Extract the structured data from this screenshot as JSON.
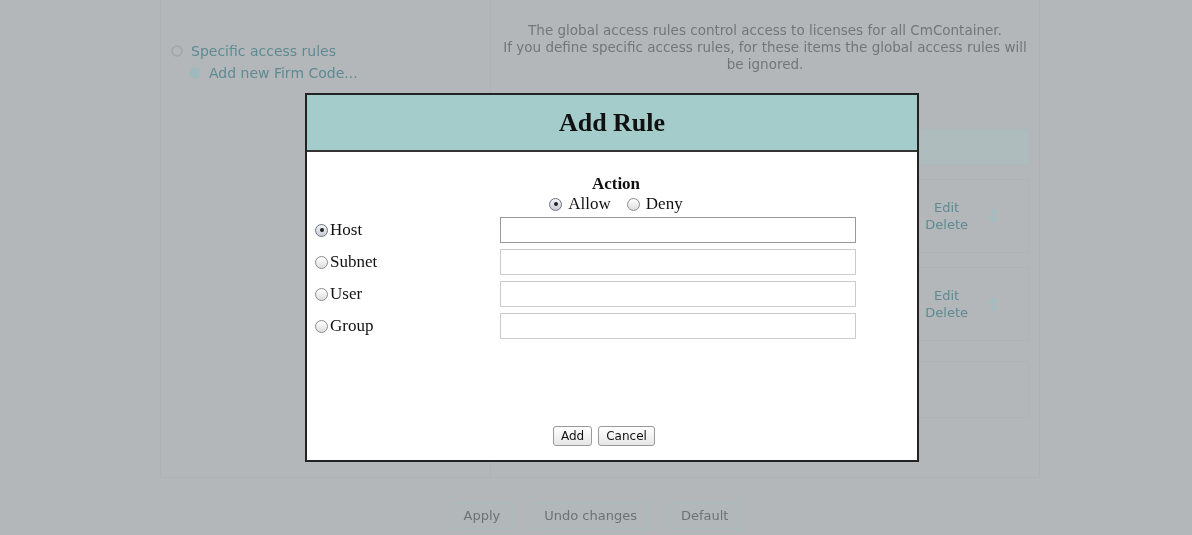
{
  "background": {
    "sidebar": [
      {
        "label": "Specific access rules",
        "kind": "group"
      },
      {
        "label": "Add new Firm Code...",
        "kind": "add"
      }
    ],
    "info": [
      "The global access rules control access to licenses for all CmContainer.",
      "If you define specific access rules, for these items the global access rules will be ignored."
    ],
    "rules": [
      {
        "edit": "Edit",
        "delete": "Delete",
        "kind": "down"
      },
      {
        "edit": "Edit",
        "delete": "Delete",
        "kind": "up"
      }
    ],
    "buttons": [
      "Apply",
      "Undo changes",
      "Default"
    ]
  },
  "dialog": {
    "title": "Add Rule",
    "action": {
      "label": "Action",
      "options": [
        {
          "label": "Allow",
          "selected": true
        },
        {
          "label": "Deny",
          "selected": false
        }
      ]
    },
    "targets": [
      {
        "label": "Host",
        "selected": true
      },
      {
        "label": "Subnet",
        "selected": false
      },
      {
        "label": "User",
        "selected": false
      },
      {
        "label": "Group",
        "selected": false
      }
    ],
    "buttons": [
      "Add",
      "Cancel"
    ]
  }
}
